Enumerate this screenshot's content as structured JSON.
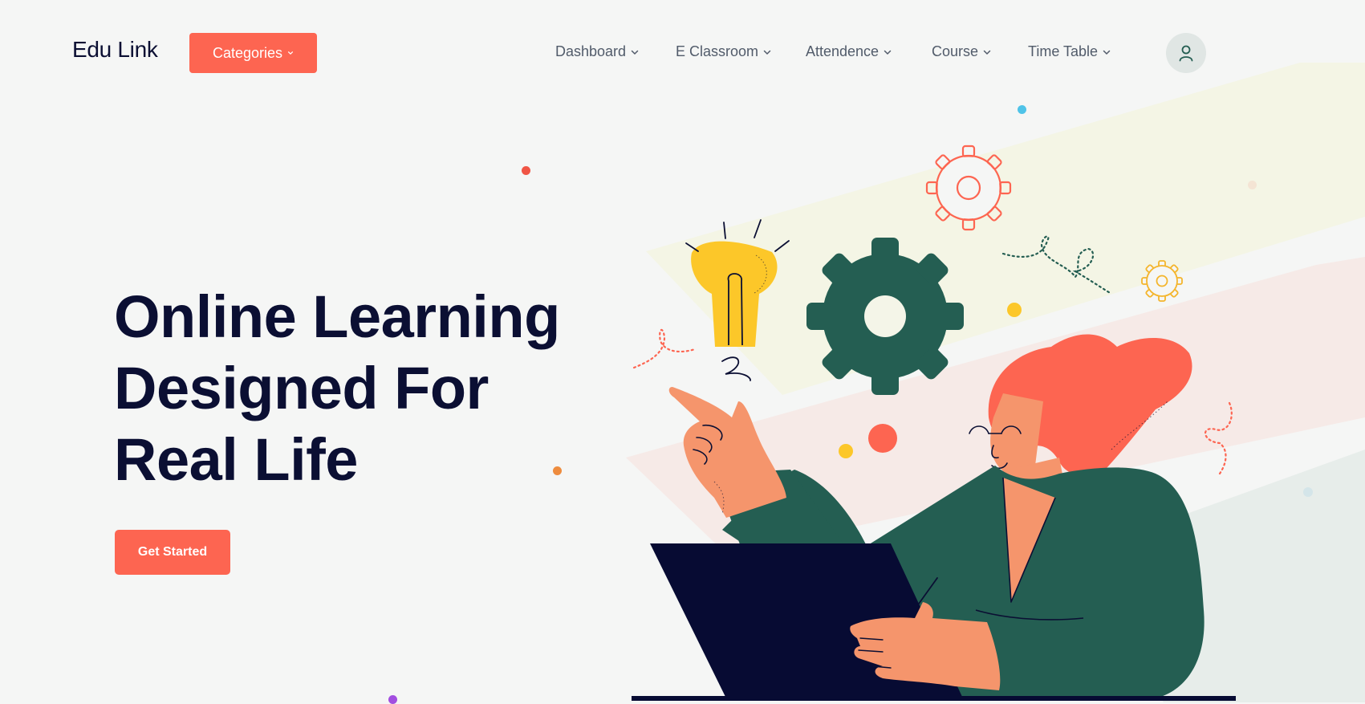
{
  "brand": {
    "name": "Edu Link"
  },
  "header": {
    "categories_label": "Categories",
    "nav": [
      {
        "label": "Dashboard"
      },
      {
        "label": "E Classroom"
      },
      {
        "label": "Attendence"
      },
      {
        "label": "Course"
      },
      {
        "label": "Time Table"
      }
    ],
    "profile_icon": "user-icon"
  },
  "hero": {
    "title_lines": [
      "Online Learning",
      "Designed For",
      "Real Life"
    ],
    "cta_label": "Get Started"
  },
  "colors": {
    "accent": "#fd6551",
    "heading": "#0b0f33",
    "nav_text": "#515b6a",
    "dark_green": "#245e52",
    "yellow": "#fcc729",
    "skin": "#f5956c",
    "background": "#f5f6f5"
  },
  "illustration": {
    "icons": [
      "lightbulb-icon",
      "gear-icon",
      "outline-gear-icon",
      "small-outline-gear-icon",
      "laptop-icon"
    ]
  }
}
